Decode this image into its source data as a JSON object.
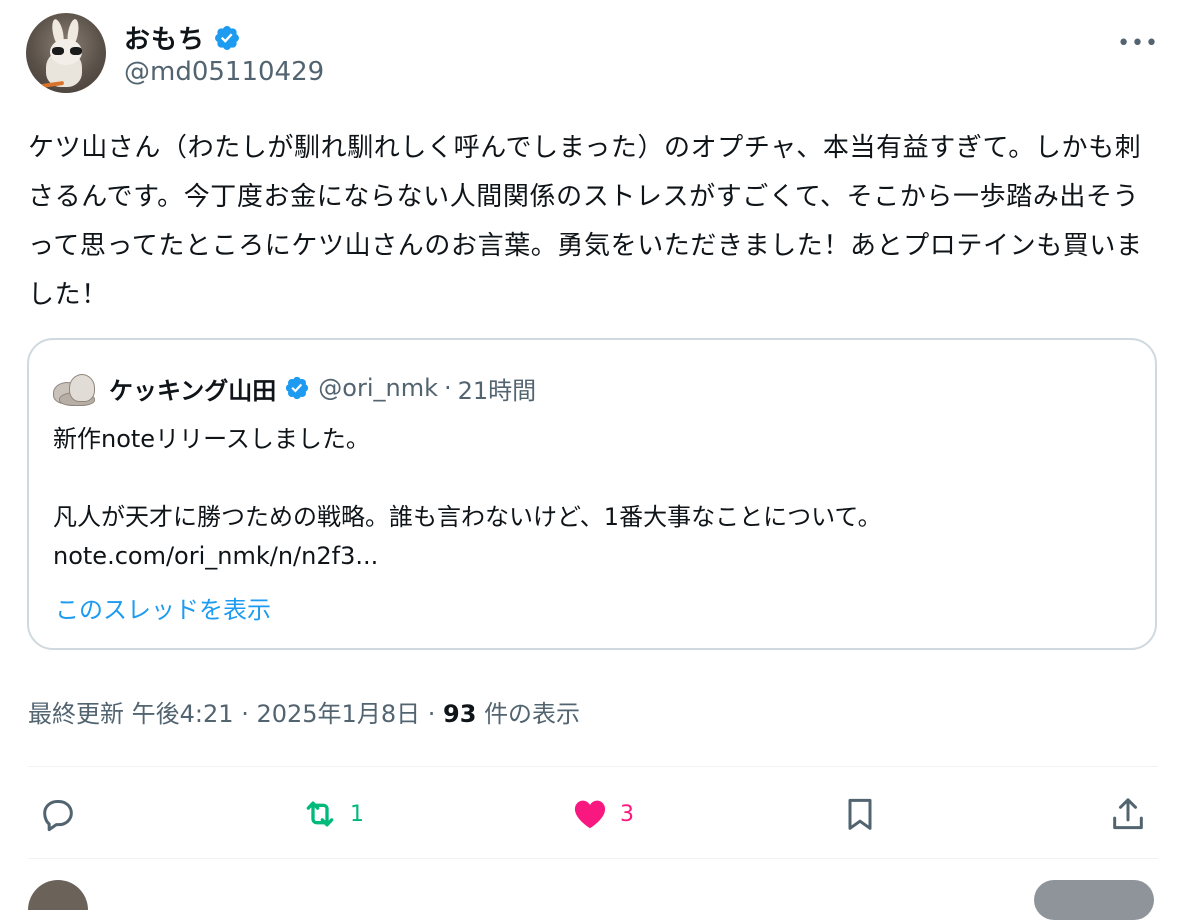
{
  "author": {
    "display_name": "おもち",
    "handle": "@md05110429"
  },
  "more_label": "•••",
  "tweet": {
    "text": "ケツ山さん（わたしが馴れ馴れしく呼んでしまった）のオプチャ、本当有益すぎて。しかも刺さるんです。今丁度お金にならない人間関係のストレスがすごくて、そこから一歩踏み出そうって思ってたところにケツ山さんのお言葉。勇気をいただきました！あとプロテインも買いました！"
  },
  "quote": {
    "display_name": "ケッキング山田",
    "handle": "@ori_nmk",
    "separator": "·",
    "time": "21時間",
    "text": "新作noteリリースしました。\n\n凡人が天才に勝つための戦略。誰も言わないけど、1番大事なことについて。\nnote.com/ori_nmk/n/n2f3...",
    "thread_link": "このスレッドを表示"
  },
  "meta": {
    "updated_label": "最終更新",
    "time": "午後4:21",
    "sep1": "·",
    "date": "2025年1月8日",
    "sep2": "·",
    "views_count": "93",
    "views_label": "件の表示"
  },
  "actions": {
    "reply_count": "",
    "retweet_count": "1",
    "like_count": "3"
  },
  "colors": {
    "verified": "#1d9bf0",
    "retweet": "#00ba7c",
    "like": "#f91880",
    "muted": "#536471"
  }
}
